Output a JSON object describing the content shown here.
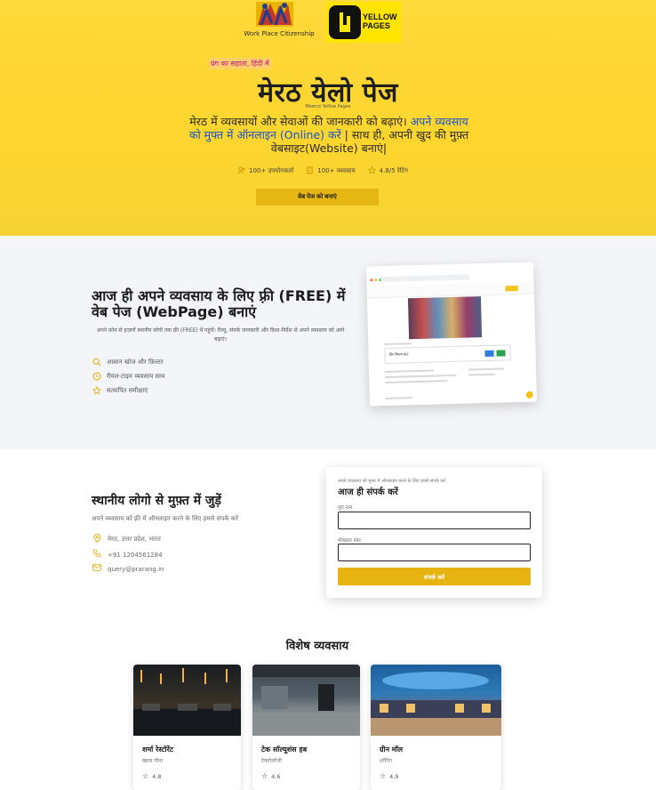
{
  "hero": {
    "wpc_logo_text": "Work Place Citizenship",
    "yp_logo_text": "YELLOW PAGES",
    "tagline": "प्रंग का सहाता, हिंदी में",
    "title": "मेरठ येलो पेज",
    "subtitle_en": "Meerut Yellow Pages",
    "desc_plain": "मेरठ में व्यवसायों और सेवाओं की जानकारी को बढ़ाएं।",
    "desc_blue": "अपने व्यवसाय को मुफ्त में ऑनलाइन (Online) करें",
    "desc_tail": " | साथ ही, अपनी खुद की मुफ़्त वेबसाइट(Website) बनाएं|",
    "stats": [
      {
        "icon": "users-icon",
        "label": "100+ उपयोगकर्ता"
      },
      {
        "icon": "building-icon",
        "label": "100+ व्यवसाय"
      },
      {
        "icon": "star-icon",
        "label": "4.8/5 रेटिंग"
      }
    ],
    "cta_label": "वेब पेज को बनाएं",
    "accent": "#fdd52e",
    "button_color": "#e6b612"
  },
  "free_page": {
    "title": "आज ही अपने व्यवसाय के लिए फ़्री (FREE) में वेब पेज (WebPage) बनाएं",
    "desc": "अपने फ़ोन से हज़ारों स्थानीय लोगों तक फ़्री (FREE) में पहुंचें। रिव्यू, संपर्क जानकारी और दिशा-निर्देश से अपने व्यवसाय को आगे बढ़ाएं।",
    "features": [
      {
        "icon": "search-icon",
        "label": "आसान खोज और फ़िल्टर"
      },
      {
        "icon": "clock-icon",
        "label": "रीयल-टाइम व्यवसाय साथ"
      },
      {
        "icon": "star-icon",
        "label": "सत्यापित समीक्षाएं"
      }
    ],
    "mockup_card_title": "ग्रीन फ़िल्म हाउ"
  },
  "connect": {
    "title": "स्थानीय लोगो से मुफ़्त में जुड़ें",
    "desc": "अपने व्यवसाय को फ़्री में ऑनलाइन करने के लिए हमसे संपर्क करें",
    "lines": [
      {
        "icon": "location-icon",
        "label": "मेरठ, उत्तर प्रदेश, भारत"
      },
      {
        "icon": "phone-icon",
        "label": "+91 1204561284"
      },
      {
        "icon": "mail-icon",
        "label": "query@prarang.in"
      }
    ],
    "form": {
      "hint": "अपने व्यवसाय को मुफ़्त में ऑनलाइन करने के लिए हमसे संपर्क करें",
      "title": "आज ही संपर्क करें",
      "name_label": "पूरा नाम",
      "name_value": "",
      "mobile_label": "मोबाइल नंबर",
      "mobile_value": "",
      "submit_label": "संपर्क करें"
    }
  },
  "featured": {
    "title": "विशेष व्यवसाय",
    "items": [
      {
        "name": "शर्मा रेस्टोरेंट",
        "category": "खाना पीना",
        "rating": "4.8"
      },
      {
        "name": "टेक सॉल्यूशंस हब",
        "category": "टेक्नोलॉजी",
        "rating": "4.6"
      },
      {
        "name": "ग्रीन मॉल",
        "category": "शॉपिंग",
        "rating": "4.9"
      }
    ]
  }
}
